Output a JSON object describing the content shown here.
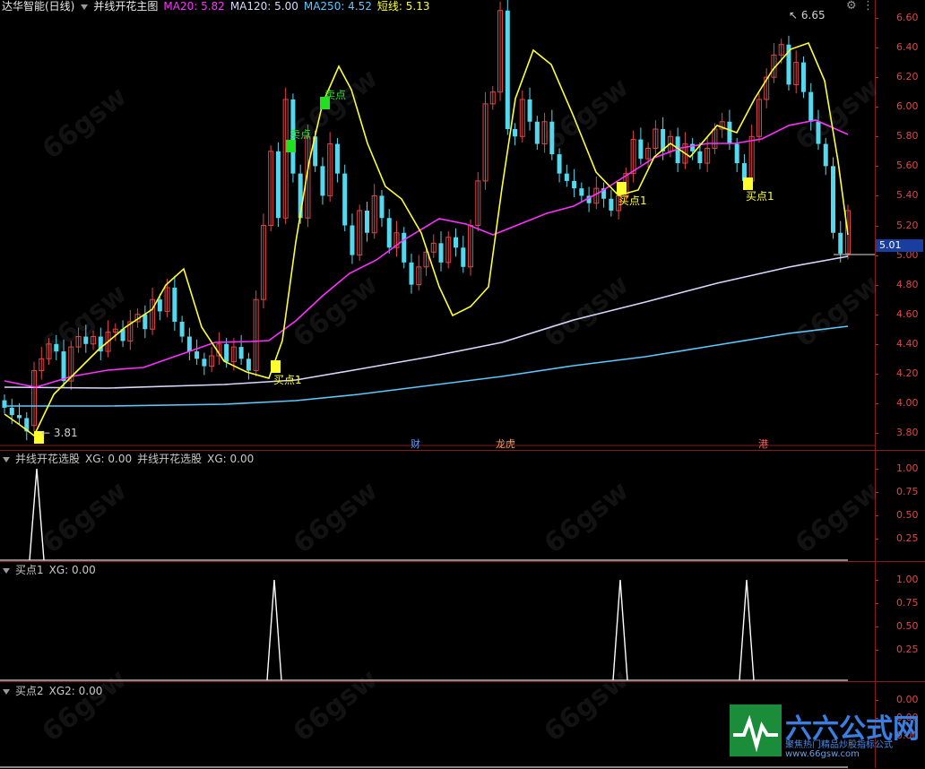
{
  "main": {
    "title": "达华智能(日线)",
    "indicator_name": "并线开花主图",
    "ma20_label": "MA20: 5.82",
    "ma120_label": "MA120: 5.00",
    "ma250_label": "MA250: 4.52",
    "short_label": "短线: 5.13",
    "high_label": "6.65",
    "low_label": "3.81",
    "current_price": "5.01",
    "axis_ticks": [
      "6.60",
      "6.40",
      "6.20",
      "6.00",
      "5.80",
      "5.60",
      "5.40",
      "5.20",
      "5.00",
      "4.80",
      "4.60",
      "4.40",
      "4.20",
      "4.00",
      "3.80"
    ],
    "markers": [
      {
        "text": "卖点",
        "kind": "sell"
      },
      {
        "text": "卖点",
        "kind": "sell"
      },
      {
        "text": "买点1",
        "kind": "buy"
      },
      {
        "text": "买点1",
        "kind": "buy"
      },
      {
        "text": "买点1",
        "kind": "buy"
      }
    ],
    "events": [
      "财",
      "龙虎",
      "港"
    ]
  },
  "panel1": {
    "label_a": "并线开花选股",
    "value_a": "XG: 0.00",
    "label_b": "并线开花选股",
    "value_b": "XG: 0.00",
    "axis_ticks": [
      "1.00",
      "0.75",
      "0.50",
      "0.25"
    ]
  },
  "panel2": {
    "label": "买点1",
    "value": "XG: 0.00",
    "axis_ticks": [
      "1.00",
      "0.75",
      "0.50",
      "0.25"
    ]
  },
  "panel3": {
    "label": "买点2",
    "value": "XG2: 0.00",
    "axis_ticks": [
      "0.00",
      "0.00",
      "0.00"
    ]
  },
  "watermark": {
    "brand": "六六公式网",
    "slogan": "聚焦热门精品炒股指标公式",
    "url": "www.66gsw.com"
  },
  "colors": {
    "up": "#e04646",
    "down": "#54d8ee",
    "ma20": "#ff30ff",
    "ma120": "#d8d8ff",
    "ma250": "#5cc8ff",
    "short": "#ffff30",
    "buy": "#ffff30",
    "sell": "#20e020"
  }
}
